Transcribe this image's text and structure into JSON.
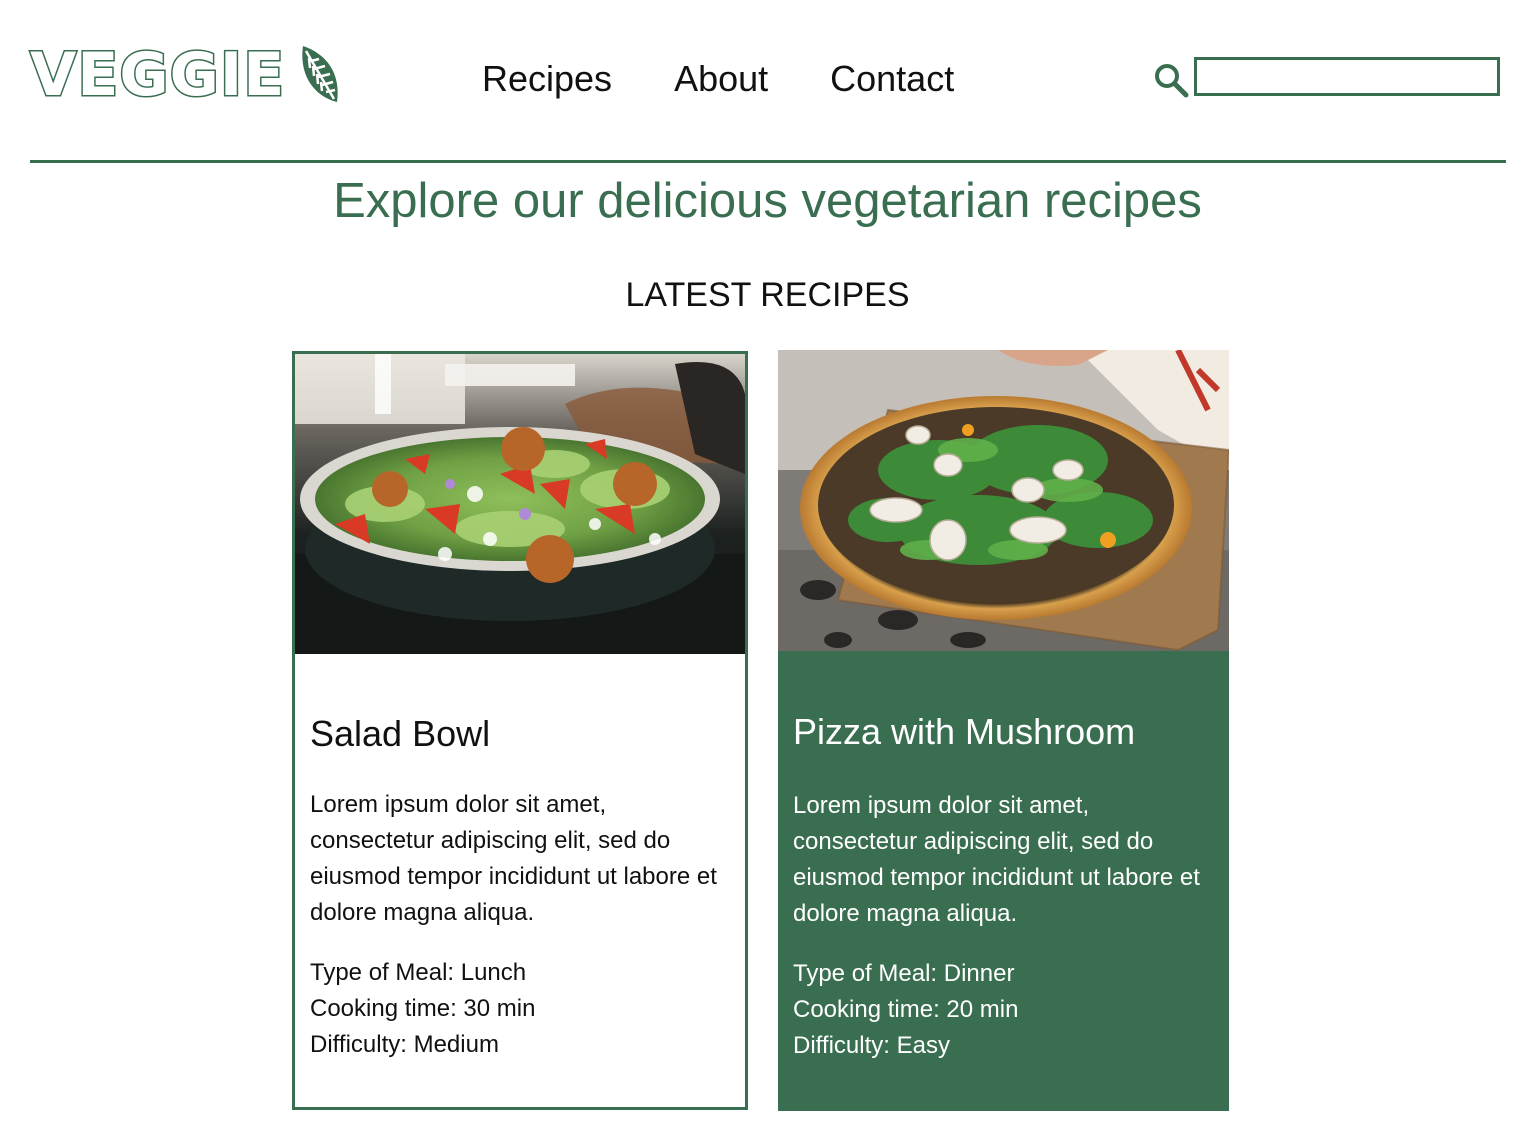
{
  "brand": {
    "name": "VEGGIE",
    "logo_icon": "leaf-icon",
    "color": "#3a6e50"
  },
  "nav": {
    "items": [
      {
        "label": "Recipes"
      },
      {
        "label": "About"
      },
      {
        "label": "Contact"
      }
    ]
  },
  "search": {
    "icon": "search-icon",
    "value": "",
    "placeholder": ""
  },
  "hero": {
    "title": "Explore our delicious vegetarian recipes"
  },
  "section": {
    "title": "LATEST RECIPES"
  },
  "cards": [
    {
      "image_alt": "salad bowl photo",
      "title": "Salad Bowl",
      "description": "Lorem ipsum dolor sit amet, consectetur adipiscing elit, sed do eiusmod tempor incididunt ut labore et dolore magna aliqua.",
      "meal_type": "Type of Meal: Lunch",
      "cooking_time": "Cooking time: 30 min",
      "difficulty": "Difficulty: Medium"
    },
    {
      "image_alt": "pizza with mushroom photo",
      "title": "Pizza with Mushroom",
      "description": "Lorem ipsum dolor sit amet, consectetur adipiscing elit, sed do eiusmod tempor incididunt ut labore et dolore magna aliqua.",
      "meal_type": "Type of Meal: Dinner",
      "cooking_time": "Cooking time: 20 min",
      "difficulty": "Difficulty: Easy"
    }
  ],
  "colors": {
    "accent": "#3a6e50",
    "text": "#111111",
    "background": "#ffffff"
  }
}
